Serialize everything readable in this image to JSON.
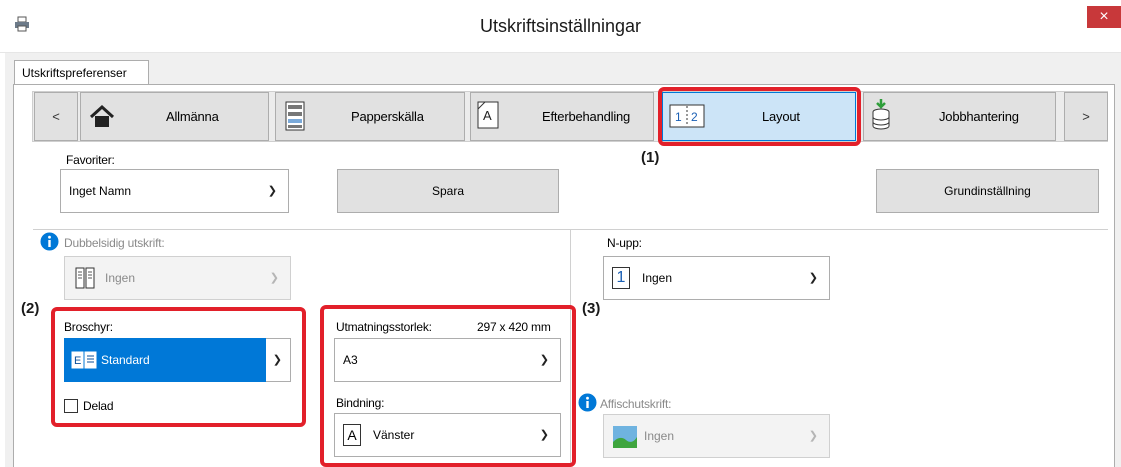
{
  "window": {
    "title": "Utskriftsinställningar",
    "close_glyph": "×"
  },
  "tab": {
    "label": "Utskriftspreferenser"
  },
  "nav": {
    "prev": "<",
    "next": ">",
    "items": [
      {
        "label": "Allmänna",
        "icon": "home-icon"
      },
      {
        "label": "Papperskälla",
        "icon": "paper-tray-icon"
      },
      {
        "label": "Efterbehandling",
        "icon": "finishing-icon"
      },
      {
        "label": "Layout",
        "icon": "layout-icon",
        "selected": true
      },
      {
        "label": "Jobbhantering",
        "icon": "job-handling-icon"
      }
    ]
  },
  "favorites": {
    "label": "Favoriter:",
    "value": "Inget Namn",
    "save": "Spara",
    "defaults": "Grundinställning"
  },
  "duplex": {
    "label": "Dubbelsidig utskrift:",
    "value": "Ingen",
    "disabled": true
  },
  "nup": {
    "label": "N-upp:",
    "icon_text": "1",
    "value": "Ingen"
  },
  "booklet": {
    "label": "Broschyr:",
    "value": "Standard",
    "split_label": "Delad",
    "split_checked": false
  },
  "output_size": {
    "label": "Utmatningsstorlek:",
    "dims": "297 x 420 mm",
    "value": "A3"
  },
  "binding": {
    "label": "Bindning:",
    "icon_text": "A",
    "value": "Vänster"
  },
  "poster": {
    "label": "Affischutskrift:",
    "value": "Ingen",
    "disabled": true
  },
  "callouts": {
    "c1": "(1)",
    "c2": "(2)",
    "c3": "(3)"
  },
  "colors": {
    "highlight": "#e2202a",
    "selection": "#0078d7",
    "info": "#0078d7"
  }
}
